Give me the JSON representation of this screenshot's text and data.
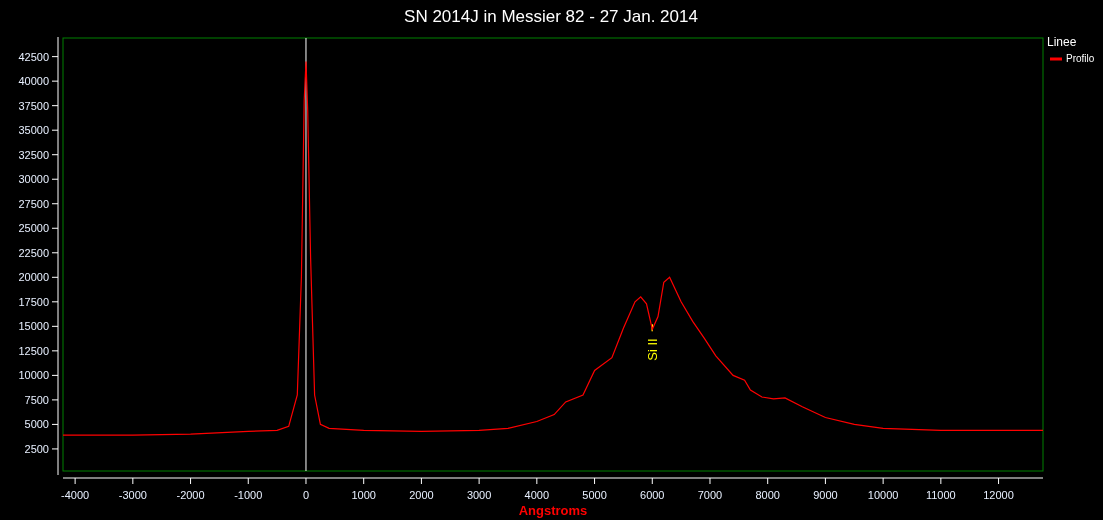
{
  "chart_data": {
    "type": "line",
    "title": "SN 2014J in Messier 82 - 27 Jan. 2014",
    "xlabel": "Angstroms",
    "xlim": [
      -4210,
      12770
    ],
    "ylim": [
      250,
      44400
    ],
    "xticks": [
      -4000,
      -3000,
      -2000,
      -1000,
      0,
      1000,
      2000,
      3000,
      4000,
      5000,
      6000,
      7000,
      8000,
      9000,
      10000,
      11000,
      12000
    ],
    "yticks": [
      2500,
      5000,
      7500,
      10000,
      12500,
      15000,
      17500,
      20000,
      22500,
      25000,
      27500,
      30000,
      32500,
      35000,
      37500,
      40000,
      42500
    ],
    "x": [
      -4210,
      -3000,
      -2000,
      -1000,
      -500,
      -300,
      -150,
      -80,
      -30,
      0,
      30,
      80,
      150,
      250,
      400,
      1000,
      2000,
      3000,
      3500,
      4000,
      4300,
      4500,
      4800,
      5000,
      5300,
      5500,
      5700,
      5800,
      5900,
      6000,
      6100,
      6200,
      6300,
      6500,
      6700,
      6900,
      7100,
      7400,
      7600,
      7700,
      7900,
      8100,
      8300,
      8600,
      9000,
      9500,
      10000,
      11000,
      12000,
      12770
    ],
    "series": [
      {
        "name": "Profilo",
        "color": "#ff0000",
        "values": [
          3900,
          3900,
          4000,
          4300,
          4400,
          4800,
          8000,
          20000,
          38000,
          42000,
          37000,
          22000,
          8000,
          5000,
          4600,
          4400,
          4300,
          4400,
          4600,
          5300,
          6000,
          7300,
          8000,
          10500,
          11800,
          14800,
          17500,
          18000,
          17300,
          14700,
          16000,
          19500,
          20000,
          17500,
          15500,
          13800,
          12000,
          10000,
          9500,
          8500,
          7800,
          7600,
          7700,
          6800,
          5700,
          5000,
          4600,
          4400,
          4400,
          4400
        ]
      }
    ],
    "ref_lines": [
      {
        "axis": "x",
        "value": 0
      }
    ],
    "annotations": [
      {
        "x": 6000,
        "y": 14600,
        "text": "Si II"
      }
    ]
  },
  "legend": {
    "title": "Linee"
  }
}
